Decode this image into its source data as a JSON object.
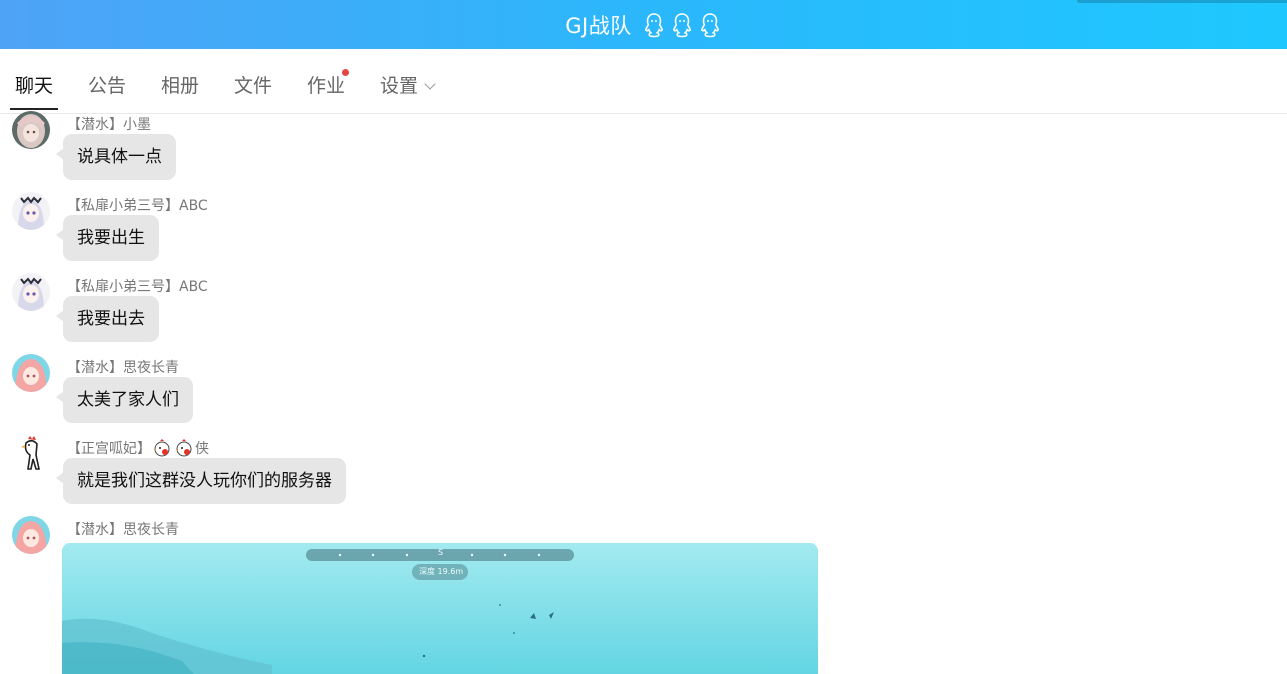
{
  "window": {
    "title": "GJ战队",
    "title_icons": [
      "qq-penguin-icon",
      "qq-penguin-icon",
      "qq-penguin-icon"
    ],
    "accent_gradient": [
      "#4fa3f7",
      "#1ec8ff"
    ]
  },
  "tabs": [
    {
      "label": "聊天",
      "active": true
    },
    {
      "label": "公告",
      "active": false
    },
    {
      "label": "相册",
      "active": false
    },
    {
      "label": "文件",
      "active": false
    },
    {
      "label": "作业",
      "active": false,
      "has_notification_dot": true
    },
    {
      "label": "设置",
      "active": false,
      "has_dropdown": true
    }
  ],
  "messages": [
    {
      "sender": "【潜水】小墨",
      "text": "说具体一点",
      "avatar": "anime-girl-avatar-grey"
    },
    {
      "sender": "【私扉小弟三号】ABC",
      "text": "我要出生",
      "avatar": "anime-girl-avatar-white-hair"
    },
    {
      "sender": "【私扉小弟三号】ABC",
      "text": "我要出去",
      "avatar": "anime-girl-avatar-white-hair"
    },
    {
      "sender": "【潜水】思夜长青",
      "text": "太美了家人们",
      "avatar": "anime-girl-avatar-pink"
    },
    {
      "sender_prefix": "【正宫呱妃】",
      "sender_suffix": "侠",
      "sender_emojis": [
        "chick-emoji",
        "chick-emoji"
      ],
      "text": "就是我们这群没人玩你们的服务器",
      "avatar": "rooster-avatar"
    },
    {
      "sender": "【潜水】思夜长青",
      "image_message": true,
      "avatar": "anime-girl-avatar-pink",
      "image_hud": {
        "compass_letter": "S",
        "depth_label": "深度 19.6m"
      }
    }
  ]
}
